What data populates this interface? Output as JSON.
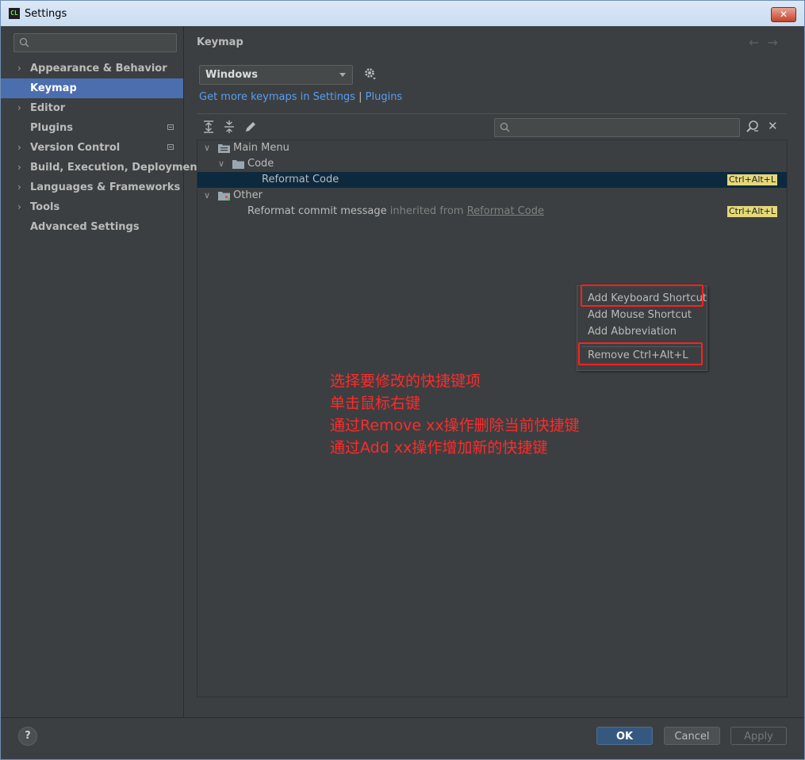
{
  "window": {
    "title": "Settings",
    "app_icon": "CL"
  },
  "sidebar": {
    "search_placeholder": "",
    "items": [
      {
        "label": "Appearance & Behavior",
        "expandable": true
      },
      {
        "label": "Keymap",
        "expandable": false,
        "selected": true
      },
      {
        "label": "Editor",
        "expandable": true
      },
      {
        "label": "Plugins",
        "expandable": false,
        "modified": true
      },
      {
        "label": "Version Control",
        "expandable": true,
        "modified": true
      },
      {
        "label": "Build, Execution, Deployment",
        "expandable": true
      },
      {
        "label": "Languages & Frameworks",
        "expandable": true
      },
      {
        "label": "Tools",
        "expandable": true
      },
      {
        "label": "Advanced Settings",
        "expandable": false
      }
    ]
  },
  "main": {
    "title": "Keymap",
    "nav_back": "←",
    "nav_forward": "→",
    "keymap_value": "Windows",
    "link_text_1": "Get more keymaps in Settings",
    "link_separator": "|",
    "link_text_2": "Plugins",
    "filter_placeholder": "",
    "clear_filter": "✕"
  },
  "tree": {
    "rows": [
      {
        "label": "Main Menu"
      },
      {
        "label": "Code"
      },
      {
        "label": "Reformat Code",
        "shortcut": "Ctrl+Alt+L"
      },
      {
        "label": "Other"
      },
      {
        "label": "Reformat commit message",
        "inherited_prefix": "inherited from",
        "inherited_link": "Reformat Code",
        "shortcut": "Ctrl+Alt+L"
      }
    ]
  },
  "context_menu": {
    "items": [
      "Add Keyboard Shortcut",
      "Add Mouse Shortcut",
      "Add Abbreviation",
      "Remove Ctrl+Alt+L"
    ]
  },
  "annotation": {
    "lines": [
      "选择要修改的快捷键项",
      "单击鼠标右键",
      "通过Remove xx操作删除当前快捷键",
      "通过Add xx操作增加新的快捷键"
    ],
    "color": "#ff2a2a"
  },
  "footer": {
    "help": "?",
    "ok": "OK",
    "cancel": "Cancel",
    "apply": "Apply"
  },
  "colors": {
    "selection": "#4b6eaf",
    "link": "#589df6",
    "shortcut_badge": "#e5d87a",
    "highlight_box": "#ff2020"
  }
}
